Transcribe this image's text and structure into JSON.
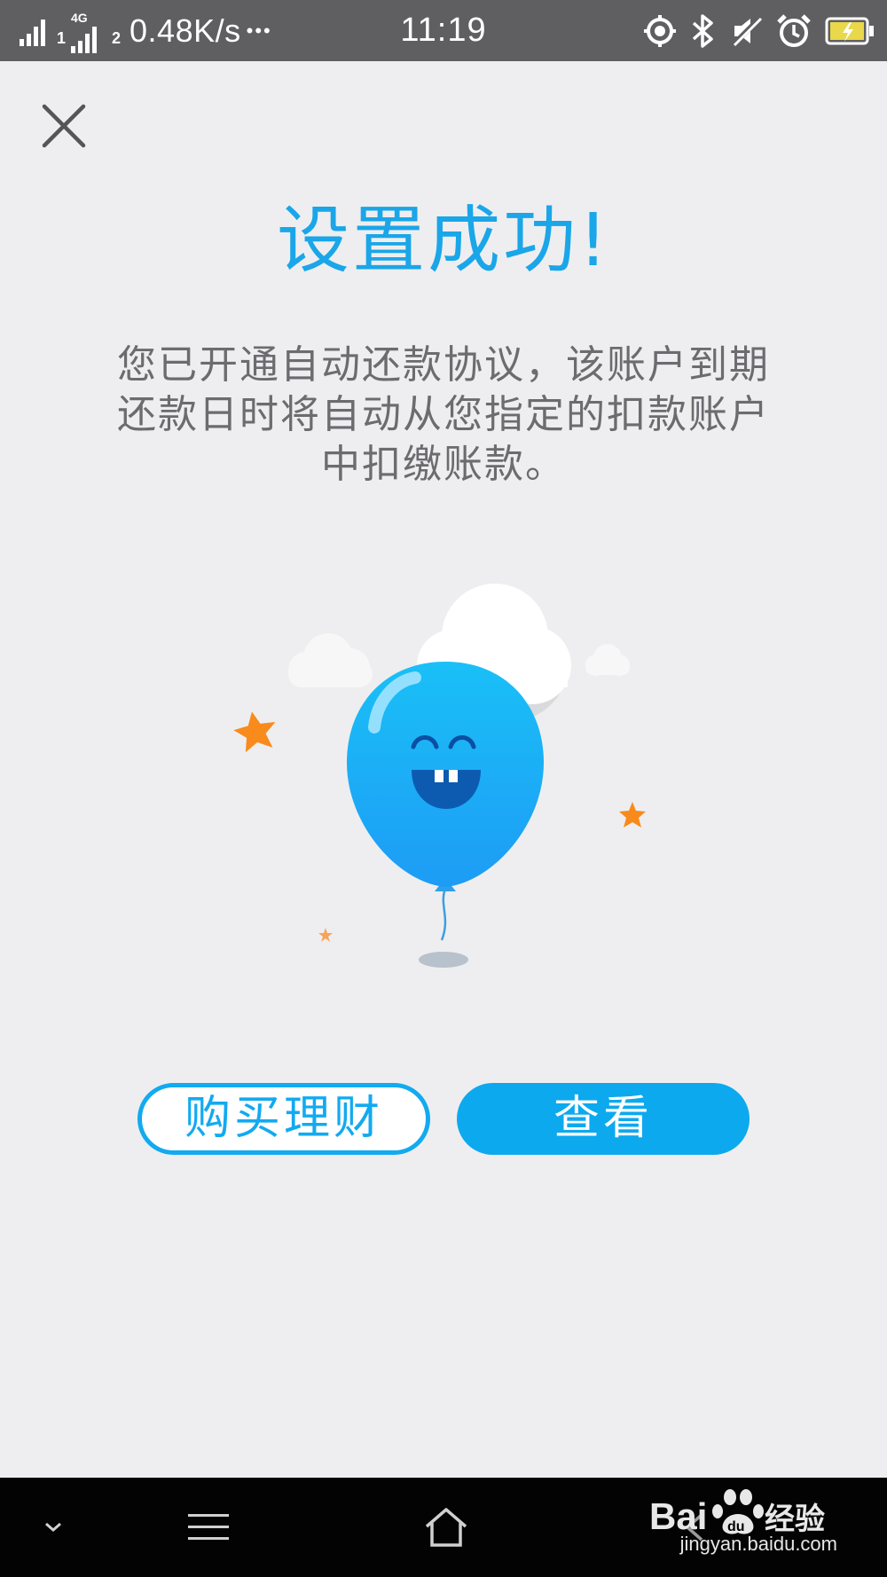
{
  "status_bar": {
    "sim1_label": "1",
    "sim2_label": "2",
    "network_type": "4G",
    "net_speed": "0.48K/s",
    "more_dots": "•••",
    "time": "11:19",
    "icons": [
      "location-icon",
      "bluetooth-icon",
      "mute-icon",
      "alarm-icon",
      "battery-charging-icon"
    ]
  },
  "page": {
    "title": "设置成功!",
    "description_lines": [
      "您已开通自动还款协议，该账户到期",
      "还款日时将自动从您指定的扣款账户",
      "中扣缴账款。"
    ]
  },
  "buttons": {
    "buy_finance": "购买理财",
    "view": "查看"
  },
  "navbar": {
    "icons": [
      "chevron-down-icon",
      "menu-icon",
      "home-icon",
      "back-icon"
    ]
  },
  "watermark": {
    "brand_text": "Bai",
    "brand_suffix": "经验",
    "url": "jingyan.baidu.com"
  },
  "colors": {
    "accent": "#12aaf0",
    "title": "#1aa6e8",
    "status_bar_bg": "#5f5f61",
    "page_bg": "#eeeef0",
    "star_orange": "#f98a1c"
  }
}
